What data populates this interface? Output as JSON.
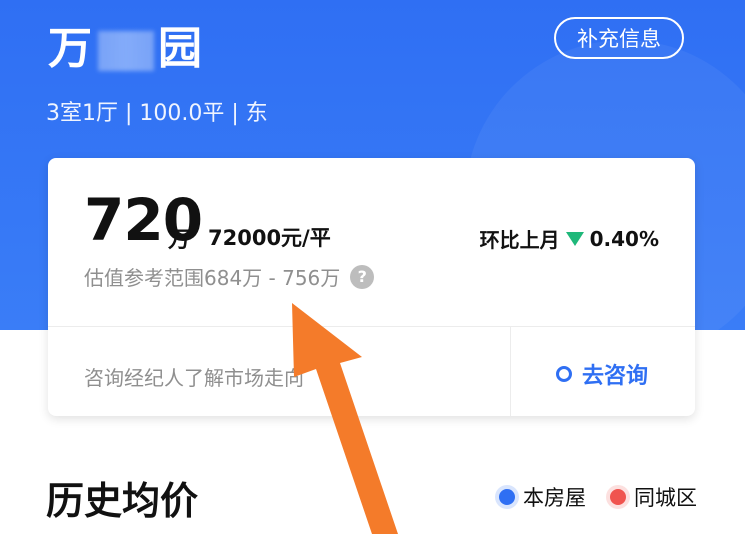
{
  "header": {
    "title_left": "万",
    "title_right": "园",
    "property_info": "3室1厅 | 100.0平 | 东",
    "supplement_label": "补充信息"
  },
  "valuation": {
    "price": "720",
    "price_unit": "万",
    "unit_price": "72000元/平",
    "mom_label": "环比上月",
    "mom_value": "0.40%",
    "range_text": "估值参考范围684万 - 756万",
    "help_glyph": "?"
  },
  "consult": {
    "prompt": "咨询经纪人了解市场走向",
    "button_label": "去咨询"
  },
  "history": {
    "title": "历史均价",
    "legend": [
      {
        "label": "本房屋",
        "color": "#2f6ff3"
      },
      {
        "label": "同城区",
        "color": "#f0544f"
      }
    ]
  },
  "colors": {
    "brand_blue": "#2f6ff3",
    "down_green": "#1fb87a",
    "annotation_arrow": "#f47b2a"
  },
  "icons": {
    "trend": "triangle-down-icon",
    "help": "question-circle-icon",
    "consult": "ring-icon"
  }
}
